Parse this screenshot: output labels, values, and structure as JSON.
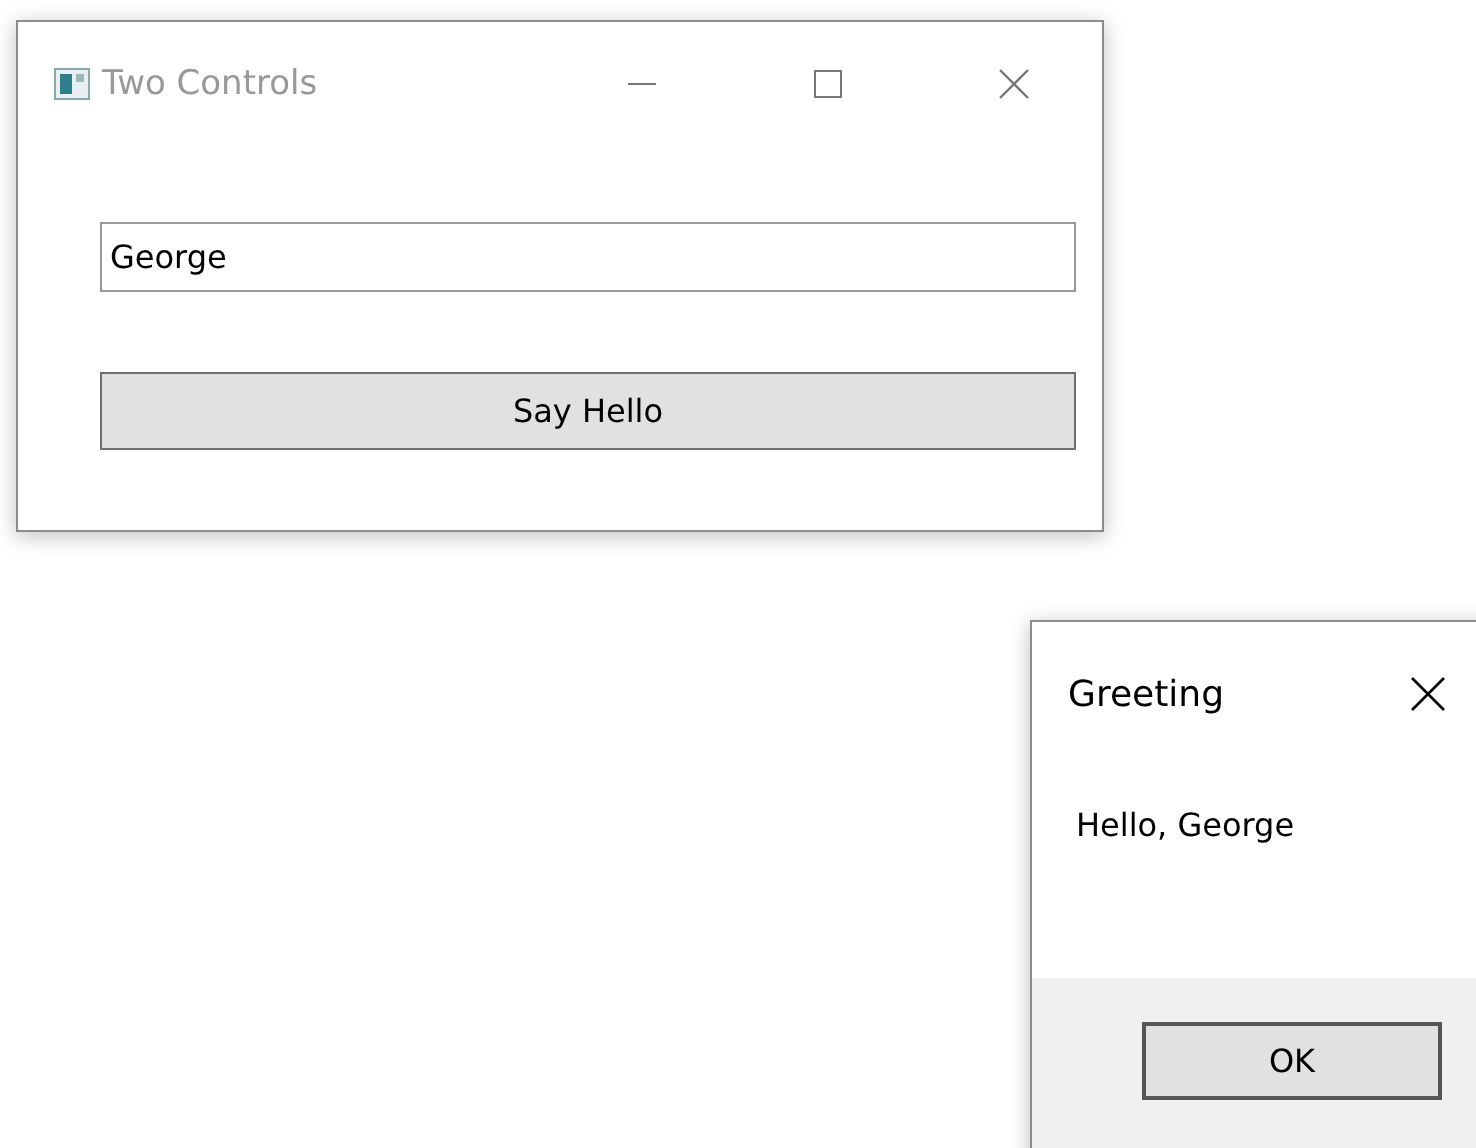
{
  "main_window": {
    "title": "Two Controls",
    "active": false,
    "name_field": {
      "value": "George"
    },
    "button": "Say Hello"
  },
  "dialog": {
    "title": "Greeting",
    "active": true,
    "message": "Hello, George",
    "button": "OK"
  }
}
